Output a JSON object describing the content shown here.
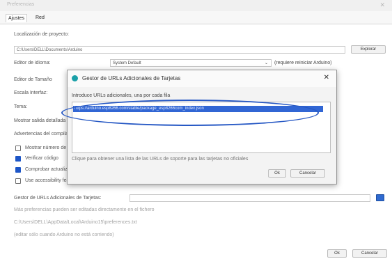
{
  "window": {
    "title": "Preferencias"
  },
  "tabs": [
    {
      "label": "Ajustes"
    },
    {
      "label": "Red"
    }
  ],
  "settings": {
    "sketchbook_label": "Localización de proyecto:",
    "sketchbook_path": "C:\\Users\\DELL\\Documents\\Arduino",
    "browse_label": "Explorar",
    "language_label": "Editor de idioma:",
    "language_value": "System Default",
    "restart_note": "(requiere reiniciar Arduino)",
    "fontsize_label": "Editor de Tamaño",
    "scale_label": "Escala Interfaz:",
    "theme_label": "Tema:",
    "verbose_label": "Mostrar salida detallada",
    "warnings_label": "Advertencias del compilador",
    "checkboxes": [
      {
        "label": "Mostrar número de línea",
        "checked": false
      },
      {
        "label": "Verificar código",
        "checked": true
      },
      {
        "label": "Comprobar actualizaciones",
        "checked": true
      },
      {
        "label": "Use accessibility features",
        "checked": false
      }
    ],
    "boards_url_label": "Gestor de URLs Adicionales de Tarjetas:",
    "more_prefs_note": "Más preferencias pueden ser editadas directamente en el fichero",
    "prefs_path": "C:\\Users\\DELL\\AppData\\Local\\Arduino15\\preferences.txt",
    "edit_note": "(editar sólo cuando Arduino no está corriendo)",
    "ok_label": "Ok",
    "cancel_label": "Cancelar"
  },
  "dialog": {
    "title": "Gestor de URLs Adicionales de Tarjetas",
    "close_glyph": "✕",
    "instruction": "Introduce URLs adicionales, una por cada fila",
    "url_value": "https://arduino.esp8266.com/stable/package_esp8266com_index.json",
    "help_link": "Clique para obtener una lista de las URLs de soporte para las tarjetas no oficiales",
    "ok_label": "Ok",
    "cancel_label": "Cancelar"
  },
  "colors": {
    "accent": "#3166d4",
    "highlight_ellipse": "#2658c4",
    "dialog_icon": "#1aa0a8"
  }
}
